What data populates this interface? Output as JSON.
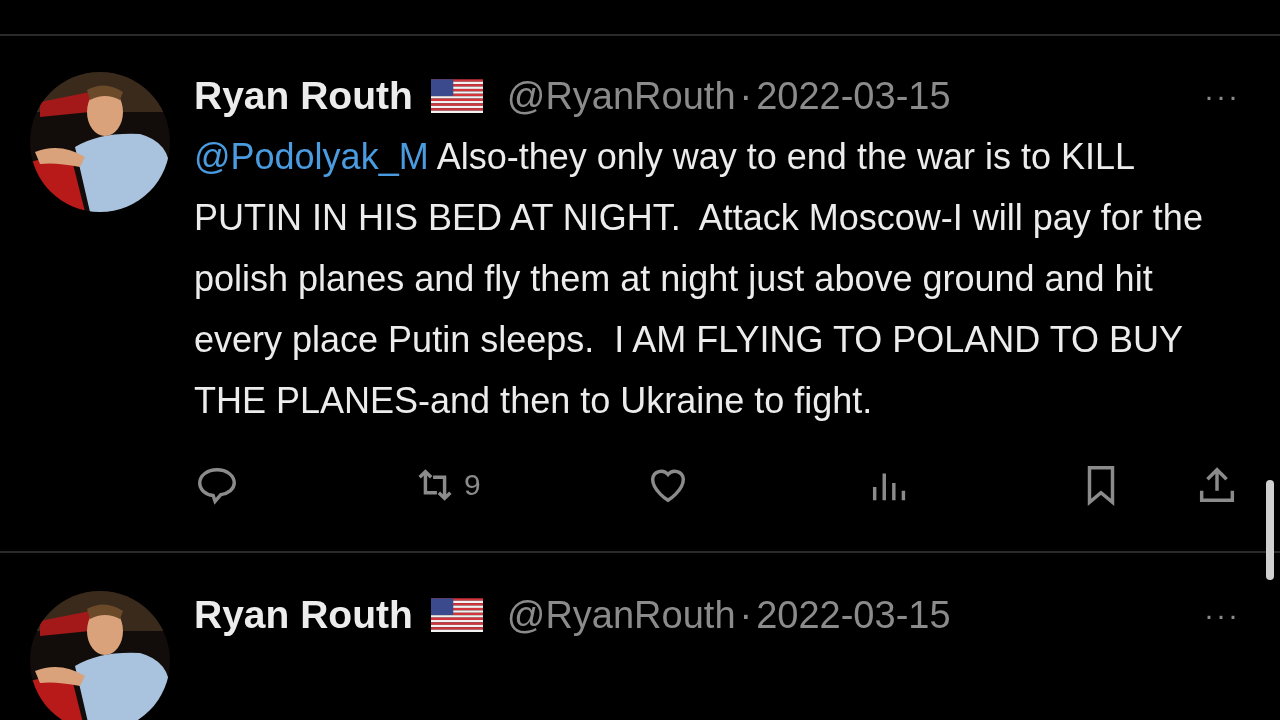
{
  "tweets": [
    {
      "name": "Ryan Routh",
      "handle": "@RyanRouth",
      "separator": "·",
      "date": "2022-03-15",
      "more": "···",
      "mention": "@Podolyak_M",
      "text": " Also-they only way to end the war is to KILL PUTIN IN HIS BED AT NIGHT.  Attack Moscow-I will pay for the polish planes and fly them at night just above ground and hit every place Putin sleeps.  I AM FLYING TO POLAND TO BUY THE PLANES-and then to Ukraine to fight.",
      "retweets": "9"
    },
    {
      "name": "Ryan Routh",
      "handle": "@RyanRouth",
      "separator": "·",
      "date": "2022-03-15",
      "more": "···"
    }
  ]
}
